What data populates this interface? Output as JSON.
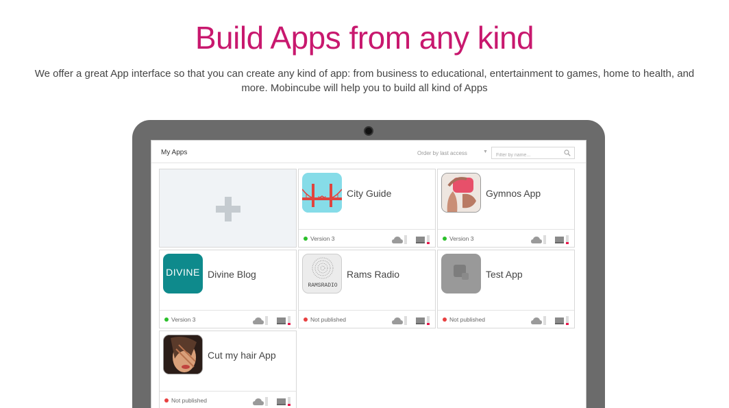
{
  "hero": {
    "title": "Build Apps from any kind",
    "description_line1": "We offer a great App interface so that you can create any kind of app: from business to educational, entertainment to games, home to health, and",
    "description_line2": "more. Mobincube will help you to build all kind of Apps"
  },
  "dashboard": {
    "title": "My Apps",
    "order_label": "Order by last access",
    "filter_placeholder": "Filter by name..."
  },
  "apps": [
    {
      "name": "City Guide",
      "status": "Version 3",
      "status_color": "#2bbf2b",
      "icon": "golden-gate-bridge-icon"
    },
    {
      "name": "Gymnos App",
      "status": "Version 3",
      "status_color": "#2bbf2b",
      "icon": "fitness-photo-icon"
    },
    {
      "name": "Divine Blog",
      "status": "Version 3",
      "status_color": "#2bbf2b",
      "icon": "divine-logo-icon",
      "icon_text": "DIVINE"
    },
    {
      "name": "Rams Radio",
      "status": "Not published",
      "status_color": "#e84040",
      "icon": "rams-radio-logo-icon",
      "icon_text": "RAMSRADIO"
    },
    {
      "name": "Test App",
      "status": "Not published",
      "status_color": "#e84040",
      "icon": "test-app-icon"
    },
    {
      "name": "Cut my hair App",
      "status": "Not published",
      "status_color": "#e84040",
      "icon": "hair-portrait-icon"
    }
  ],
  "colors": {
    "accent": "#c8186e",
    "laptop_frame": "#6b6b6b",
    "published": "#2bbf2b",
    "unpublished": "#e84040"
  }
}
